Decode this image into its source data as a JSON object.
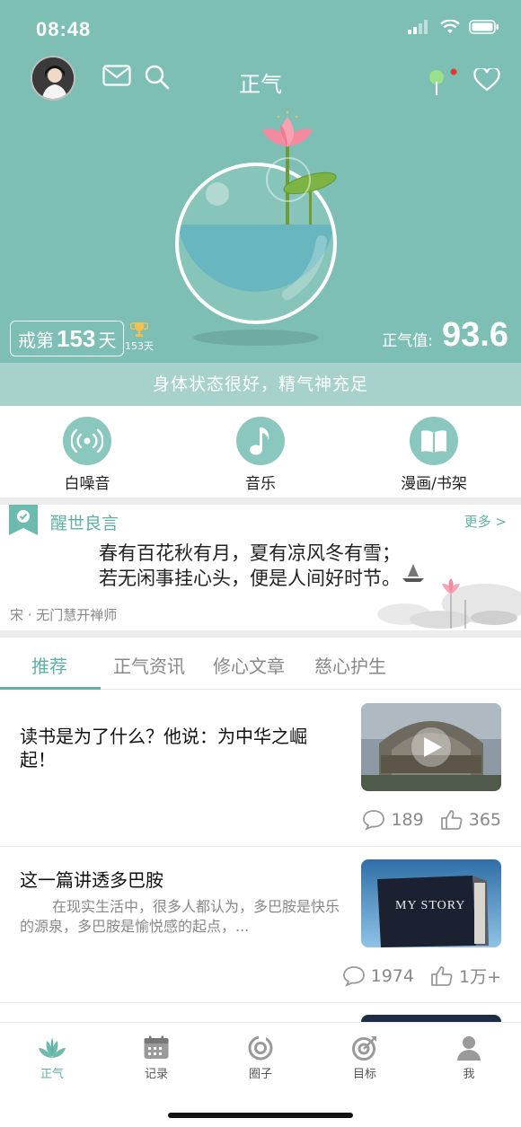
{
  "status_bar": {
    "time": "08:48"
  },
  "header": {
    "title": "正气"
  },
  "hero": {
    "counter_prefix": "戒第",
    "counter_days": "153",
    "counter_suffix": "天",
    "trophy_days": "153天",
    "qi_label": "正气值:",
    "qi_value": "93.6"
  },
  "state_message": "身体状态很好，精气神充足",
  "quick_actions": [
    {
      "label": "白噪音",
      "icon": "radio-waves-icon"
    },
    {
      "label": "音乐",
      "icon": "music-note-icon"
    },
    {
      "label": "漫画/书架",
      "icon": "open-book-icon"
    }
  ],
  "quote": {
    "title": "醒世良言",
    "more": "更多 >",
    "line1": "春有百花秋有月，夏有凉风冬有雪；",
    "line2": "若无闲事挂心头，便是人间好时节。",
    "author": "宋 · 无门慧开禅师"
  },
  "tabs": [
    {
      "label": "推荐",
      "active": true
    },
    {
      "label": "正气资讯",
      "active": false
    },
    {
      "label": "修心文章",
      "active": false
    },
    {
      "label": "慈心护生",
      "active": false
    }
  ],
  "articles": [
    {
      "title": "读书是为了什么？他说：为中华之崛起！",
      "summary": "",
      "thumb_type": "video",
      "comments": "189",
      "likes": "365"
    },
    {
      "title": "这一篇讲透多巴胺",
      "summary": "在现实生活中，很多人都认为，多巴胺是快乐的源泉，多巴胺是愉悦感的起点，...",
      "thumb_text": "MY STORY",
      "comments": "1974",
      "likes": "1万+"
    }
  ],
  "tab_bar": [
    {
      "label": "正气",
      "icon": "lotus-icon",
      "active": true
    },
    {
      "label": "记录",
      "icon": "calendar-icon",
      "active": false
    },
    {
      "label": "圈子",
      "icon": "circle-icon",
      "active": false
    },
    {
      "label": "目标",
      "icon": "target-icon",
      "active": false
    },
    {
      "label": "我",
      "icon": "person-icon",
      "active": false
    }
  ],
  "colors": {
    "hero_bg": "#7dbfb4",
    "accent": "#5fb1a5",
    "state_bar": "#a6d2cb",
    "notification_dot": "#e53935"
  }
}
